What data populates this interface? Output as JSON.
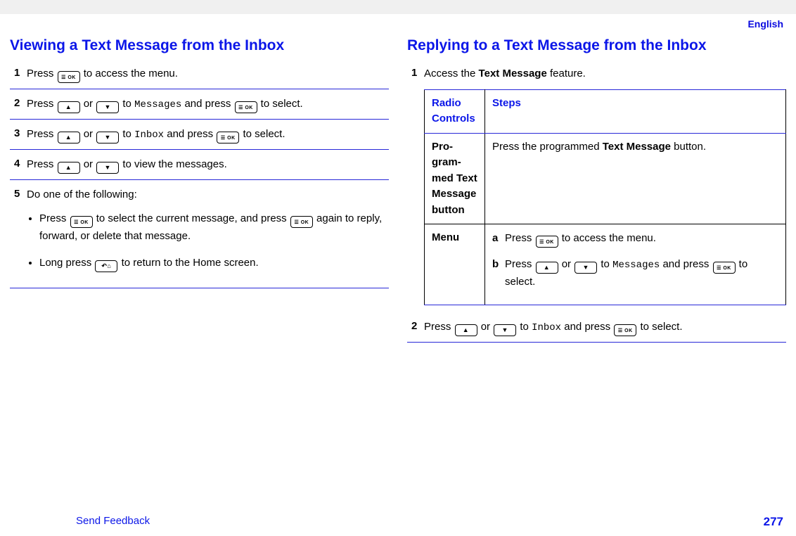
{
  "lang": "English",
  "footer": {
    "feedback": "Send Feedback",
    "page": "277"
  },
  "left": {
    "heading": "Viewing a Text Message from the Inbox",
    "s1_a": "Press ",
    "s1_b": " to access the menu.",
    "s2_a": "Press ",
    "s2_or": " or ",
    "s2_b": " to ",
    "s2_msg": "Messages",
    "s2_c": " and press ",
    "s2_d": " to select.",
    "s3_a": "Press ",
    "s3_or": " or ",
    "s3_b": " to ",
    "s3_inbox": "Inbox",
    "s3_c": " and press ",
    "s3_d": " to select.",
    "s4_a": "Press ",
    "s4_or": " or ",
    "s4_b": " to view the messages.",
    "s5_intro": "Do one of the following:",
    "s5_li1_a": "Press ",
    "s5_li1_b": " to select the current message, and press ",
    "s5_li1_c": " again to reply, forward, or delete that message.",
    "s5_li2_a": "Long press ",
    "s5_li2_b": " to return to the Home screen."
  },
  "right": {
    "heading": "Replying to a Text Message from the Inbox",
    "s1_a": "Access the ",
    "s1_bold": "Text Message",
    "s1_b": " feature.",
    "th1": "Radio Controls",
    "th2": "Steps",
    "row1_c1_a": "Pro­gram­med Text Message button",
    "row1_c2_a": "Press the programmed ",
    "row1_c2_bold": "Text Mes­sage",
    "row1_c2_b": " button.",
    "row2_c1": "Menu",
    "row2_a_a": "Press ",
    "row2_a_b": " to access the menu.",
    "row2_b_a": "Press ",
    "row2_b_or": " or ",
    "row2_b_b": " to ",
    "row2_b_msg": "Messag­es",
    "row2_b_c": " and press ",
    "row2_b_d": " to select.",
    "s2_a": "Press ",
    "s2_or": " or ",
    "s2_b": " to ",
    "s2_inbox": "Inbox",
    "s2_c": " and press ",
    "s2_d": " to select."
  }
}
